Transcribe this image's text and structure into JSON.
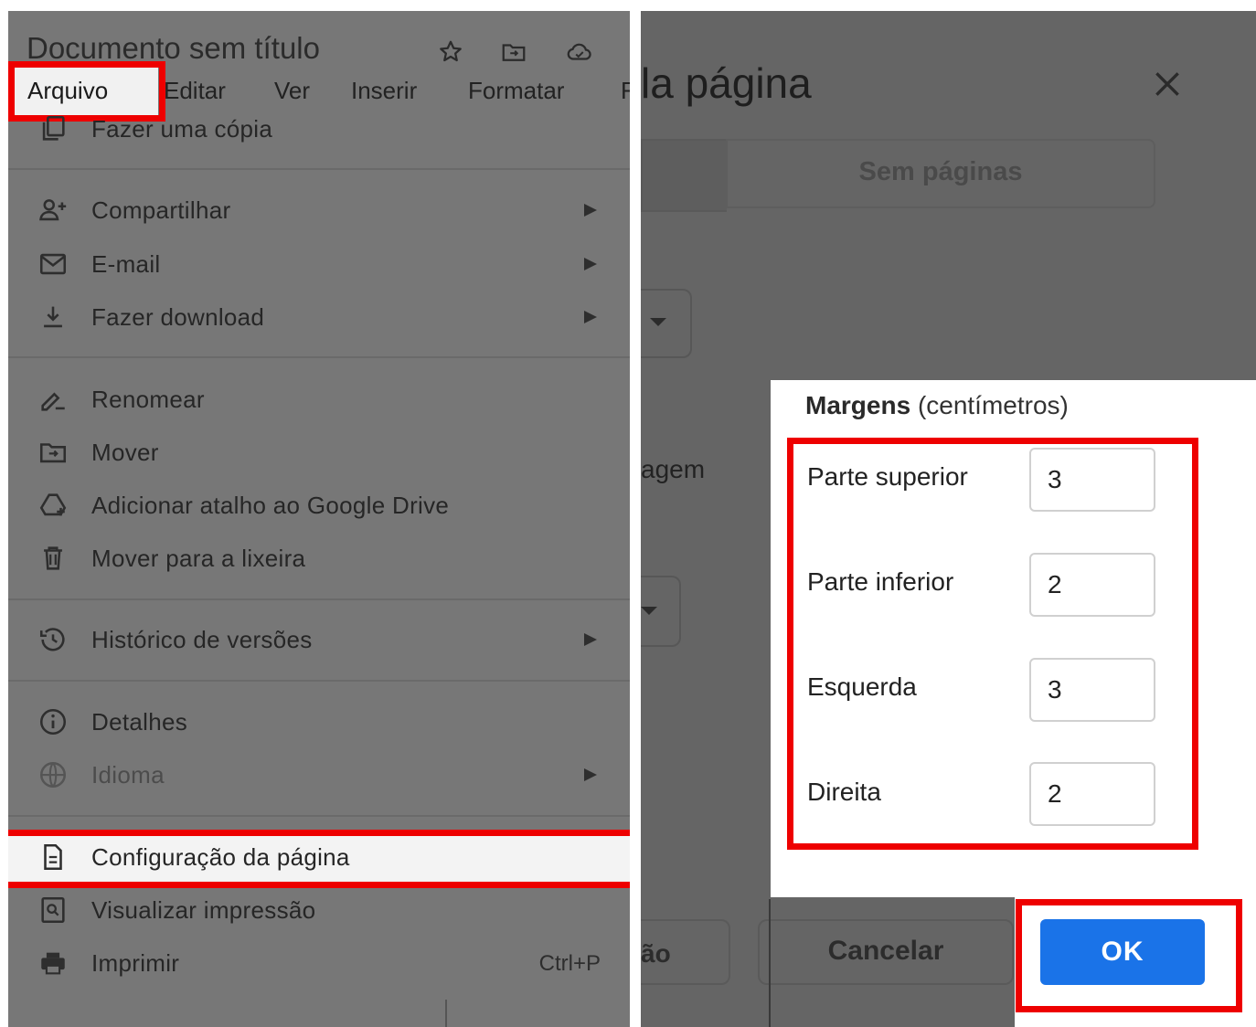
{
  "docs": {
    "doc_title": "Documento sem título",
    "header_icons": [
      "star-icon",
      "move-folder-icon",
      "cloud-status-icon"
    ],
    "menubar": [
      "Arquivo",
      "Editar",
      "Ver",
      "Inserir",
      "Formatar",
      "F"
    ],
    "file_menu": {
      "make_copy": "Fazer uma cópia",
      "share": "Compartilhar",
      "email": "E-mail",
      "download": "Fazer download",
      "rename": "Renomear",
      "move": "Mover",
      "add_shortcut": "Adicionar atalho ao Google Drive",
      "trash": "Mover para a lixeira",
      "version_history": "Histórico de versões",
      "details": "Detalhes",
      "language": "Idioma",
      "page_setup": "Configuração da página",
      "print_preview": "Visualizar impressão",
      "print": "Imprimir",
      "print_shortcut": "Ctrl+P"
    }
  },
  "page_setup_dialog": {
    "title_fragment": "la página",
    "tab_no_pages": "Sem páginas",
    "orientation_fragment": "agem",
    "set_default_fragment": "ão",
    "margins_heading": "Margens",
    "margins_unit": "(centímetros)",
    "margins": [
      {
        "label": "Parte superior",
        "value": "3"
      },
      {
        "label": "Parte inferior",
        "value": "2"
      },
      {
        "label": "Esquerda",
        "value": "3"
      },
      {
        "label": "Direita",
        "value": "2"
      }
    ],
    "cancel_label": "Cancelar",
    "ok_label": "OK"
  },
  "colors": {
    "highlight": "#ee0000",
    "ok_button": "#1a73e8",
    "overlay": "#777777"
  }
}
